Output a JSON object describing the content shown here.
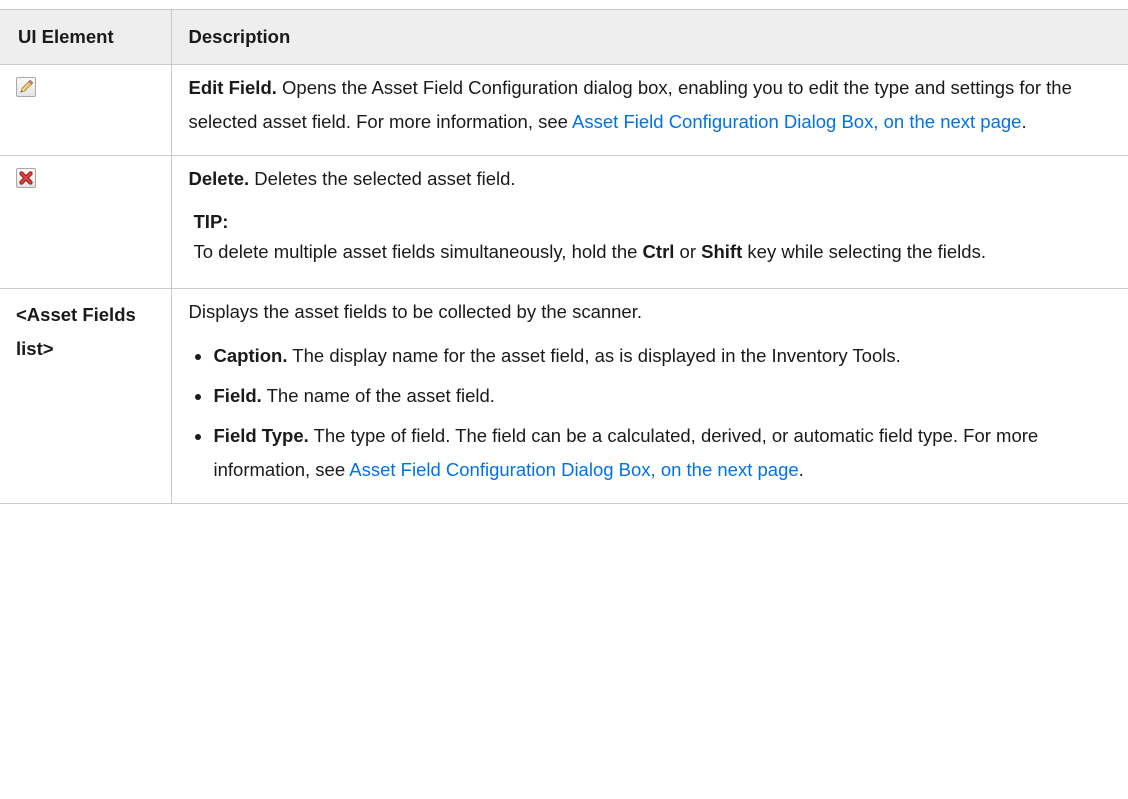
{
  "table": {
    "headers": {
      "element": "UI Element",
      "description": "Description"
    },
    "rows": {
      "edit": {
        "icon": "pencil-edit-icon",
        "title": "Edit Field.",
        "text": " Opens the Asset Field Configuration dialog box, enabling you to edit the type and settings for the selected asset field. For more information, see ",
        "link": "Asset Field Configuration Dialog Box, on the next page",
        "after": "."
      },
      "delete": {
        "icon": "red-x-delete-icon",
        "title": "Delete.",
        "text": " Deletes the selected asset field.",
        "tip_label": "TIP:",
        "tip_pre": "To delete multiple asset fields simultaneously, hold the ",
        "tip_ctrl": "Ctrl",
        "tip_or": " or ",
        "tip_shift": "Shift",
        "tip_post": " key while selecting the fields."
      },
      "list": {
        "element_label": "<Asset Fields list>",
        "intro": "Displays the asset fields to be collected by the scanner.",
        "bullets": {
          "caption": {
            "title": "Caption.",
            "text": " The display name for the asset field, as is displayed in the Inventory Tools."
          },
          "field": {
            "title": "Field.",
            "text": " The name of the asset field."
          },
          "field_type": {
            "title": "Field Type.",
            "text": " The type of field. The field can be a calculated, derived, or automatic field type. For more information, see ",
            "link": "Asset Field Configuration Dialog Box, on the next page",
            "after": "."
          }
        }
      }
    }
  }
}
